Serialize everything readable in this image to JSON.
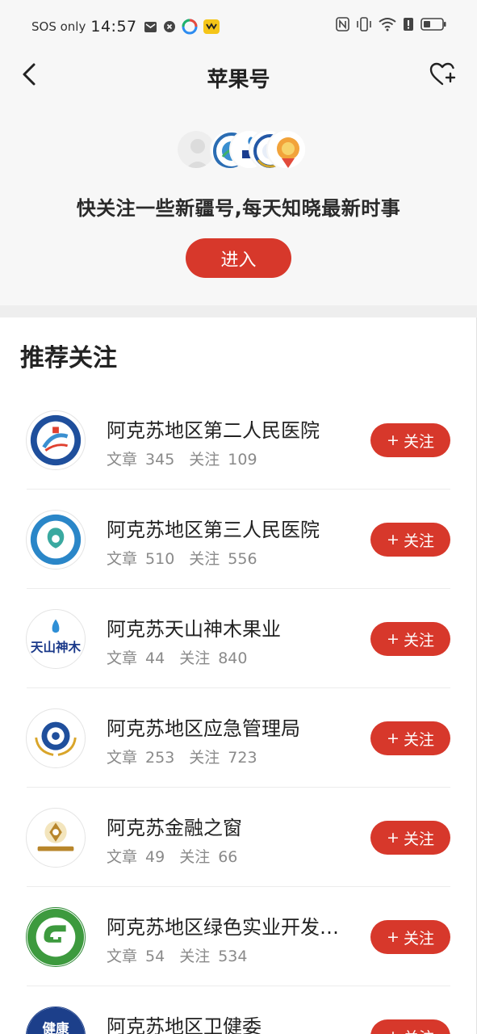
{
  "status_bar": {
    "carrier": "SOS only",
    "time": "14:57"
  },
  "header": {
    "title": "苹果号",
    "back_icon": "chevron-left-icon",
    "favorite_icon": "heart-plus-icon"
  },
  "hero": {
    "headline": "快关注一些新疆号,每天知晓最新时事",
    "enter_label": "进入"
  },
  "section": {
    "title": "推荐关注"
  },
  "labels": {
    "articles": "文章",
    "follows": "关注",
    "follow_button": "关注",
    "plus": "+"
  },
  "accounts": [
    {
      "name": "阿克苏地区第二人民医院",
      "articles": "345",
      "follows": "109"
    },
    {
      "name": "阿克苏地区第三人民医院",
      "articles": "510",
      "follows": "556"
    },
    {
      "name": "阿克苏天山神木果业",
      "articles": "44",
      "follows": "840"
    },
    {
      "name": "阿克苏地区应急管理局",
      "articles": "253",
      "follows": "723"
    },
    {
      "name": "阿克苏金融之窗",
      "articles": "49",
      "follows": "66"
    },
    {
      "name": "阿克苏地区绿色实业开发…",
      "articles": "54",
      "follows": "534"
    },
    {
      "name": "阿克苏地区卫健委",
      "articles": "",
      "follows": ""
    }
  ],
  "logo_text": {
    "tianshan": "天山神木",
    "health": "健康"
  },
  "colors": {
    "accent": "#d7382b",
    "background": "#f7f7f7"
  }
}
